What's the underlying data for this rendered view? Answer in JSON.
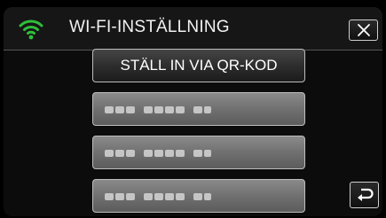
{
  "header": {
    "title": "WI-FI-INSTÄLLNING",
    "wifi_icon": "wifi-signal-icon",
    "close_icon": "close-icon"
  },
  "options": [
    {
      "label": "STÄLL IN VIA QR-KOD",
      "obscured": false
    },
    {
      "label": "",
      "obscured": true
    },
    {
      "label": "",
      "obscured": true
    },
    {
      "label": "",
      "obscured": true
    }
  ],
  "footer": {
    "back_icon": "return-arrow-icon"
  },
  "colors": {
    "wifi": "#2fbf3a",
    "background": "#0c0c0c",
    "text": "#ffffff"
  }
}
